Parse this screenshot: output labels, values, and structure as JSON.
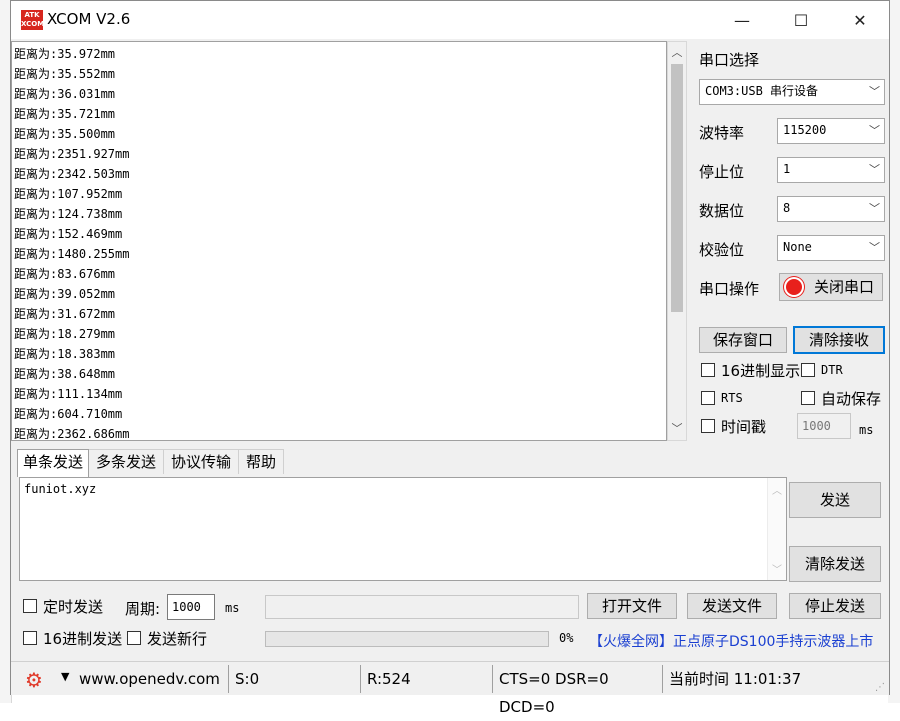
{
  "window": {
    "title": "XCOM V2.6",
    "icon_text": "ATK XCOM"
  },
  "title_buttons": {
    "minimize": "—",
    "maximize": "☐",
    "close": "✕"
  },
  "receive_lines": [
    "距离为:35.972mm",
    "距离为:35.552mm",
    "距离为:36.031mm",
    "距离为:35.721mm",
    "距离为:35.500mm",
    "距离为:2351.927mm",
    "距离为:2342.503mm",
    "距离为:107.952mm",
    "距离为:124.738mm",
    "距离为:152.469mm",
    "距离为:1480.255mm",
    "距离为:83.676mm",
    "距离为:39.052mm",
    "距离为:31.672mm",
    "距离为:18.279mm",
    "距离为:18.383mm",
    "距离为:38.648mm",
    "距离为:111.134mm",
    "距离为:604.710mm",
    "距离为:2362.686mm"
  ],
  "panel": {
    "port_select_label": "串口选择",
    "port_value": "COM3:USB 串行设备",
    "baud_label": "波特率",
    "baud_value": "115200",
    "stop_label": "停止位",
    "stop_value": "1",
    "data_label": "数据位",
    "data_value": "8",
    "parity_label": "校验位",
    "parity_value": "None",
    "op_label": "串口操作",
    "op_button": "关闭串口",
    "save_window": "保存窗口",
    "clear_receive": "清除接收",
    "hex_display": "16进制显示",
    "dtr": "DTR",
    "rts": "RTS",
    "auto_save": "自动保存",
    "timestamp": "时间戳",
    "timestamp_value": "1000",
    "timestamp_unit": "ms"
  },
  "tabs": [
    "单条发送",
    "多条发送",
    "协议传输",
    "帮助"
  ],
  "send": {
    "text": "funiot.xyz",
    "send_button": "发送",
    "clear_send_button": "清除发送",
    "timed_send": "定时发送",
    "period_label": "周期:",
    "period_value": "1000",
    "period_unit": "ms",
    "open_file": "打开文件",
    "send_file": "发送文件",
    "stop_send": "停止发送",
    "hex_send": "16进制发送",
    "send_newline": "发送新行",
    "progress_text": "0%",
    "progress": 0
  },
  "ad_text": "【火爆全网】正点原子DS100手持示波器上市",
  "status": {
    "url": "www.openedv.com",
    "s": "S:0",
    "r": "R:524",
    "lines": "CTS=0 DSR=0 DCD=0",
    "time": "当前时间 11:01:37"
  },
  "colors": {
    "accent": "#0078d7",
    "ad": "#1a3fd1",
    "icon_red": "#d7261e"
  }
}
